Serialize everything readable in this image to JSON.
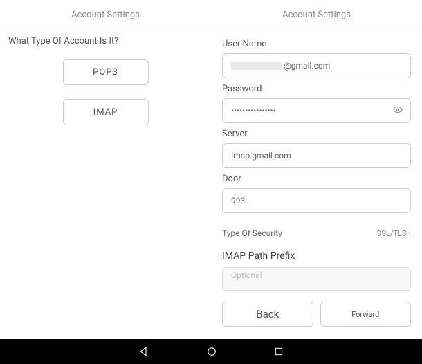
{
  "left": {
    "header": "Account Settings",
    "question": "What Type Of Account Is It?",
    "pop3_label": "POP3",
    "imap_label": "IMAP"
  },
  "right": {
    "header": "Account Settings",
    "username_label": "User Name",
    "username_domain": "@gmail.com",
    "password_label": "Password",
    "password_value": "••••••••••••••••",
    "server_label": "Server",
    "server_value": "Imap.gmail.com",
    "door_label": "Door",
    "door_value": "993",
    "security_label": "Type Of Security",
    "security_value": "SSL/TLS",
    "prefix_label": "IMAP Path Prefix",
    "prefix_placeholder": "Optional",
    "back_label": "Back",
    "forward_label": "Forward"
  }
}
